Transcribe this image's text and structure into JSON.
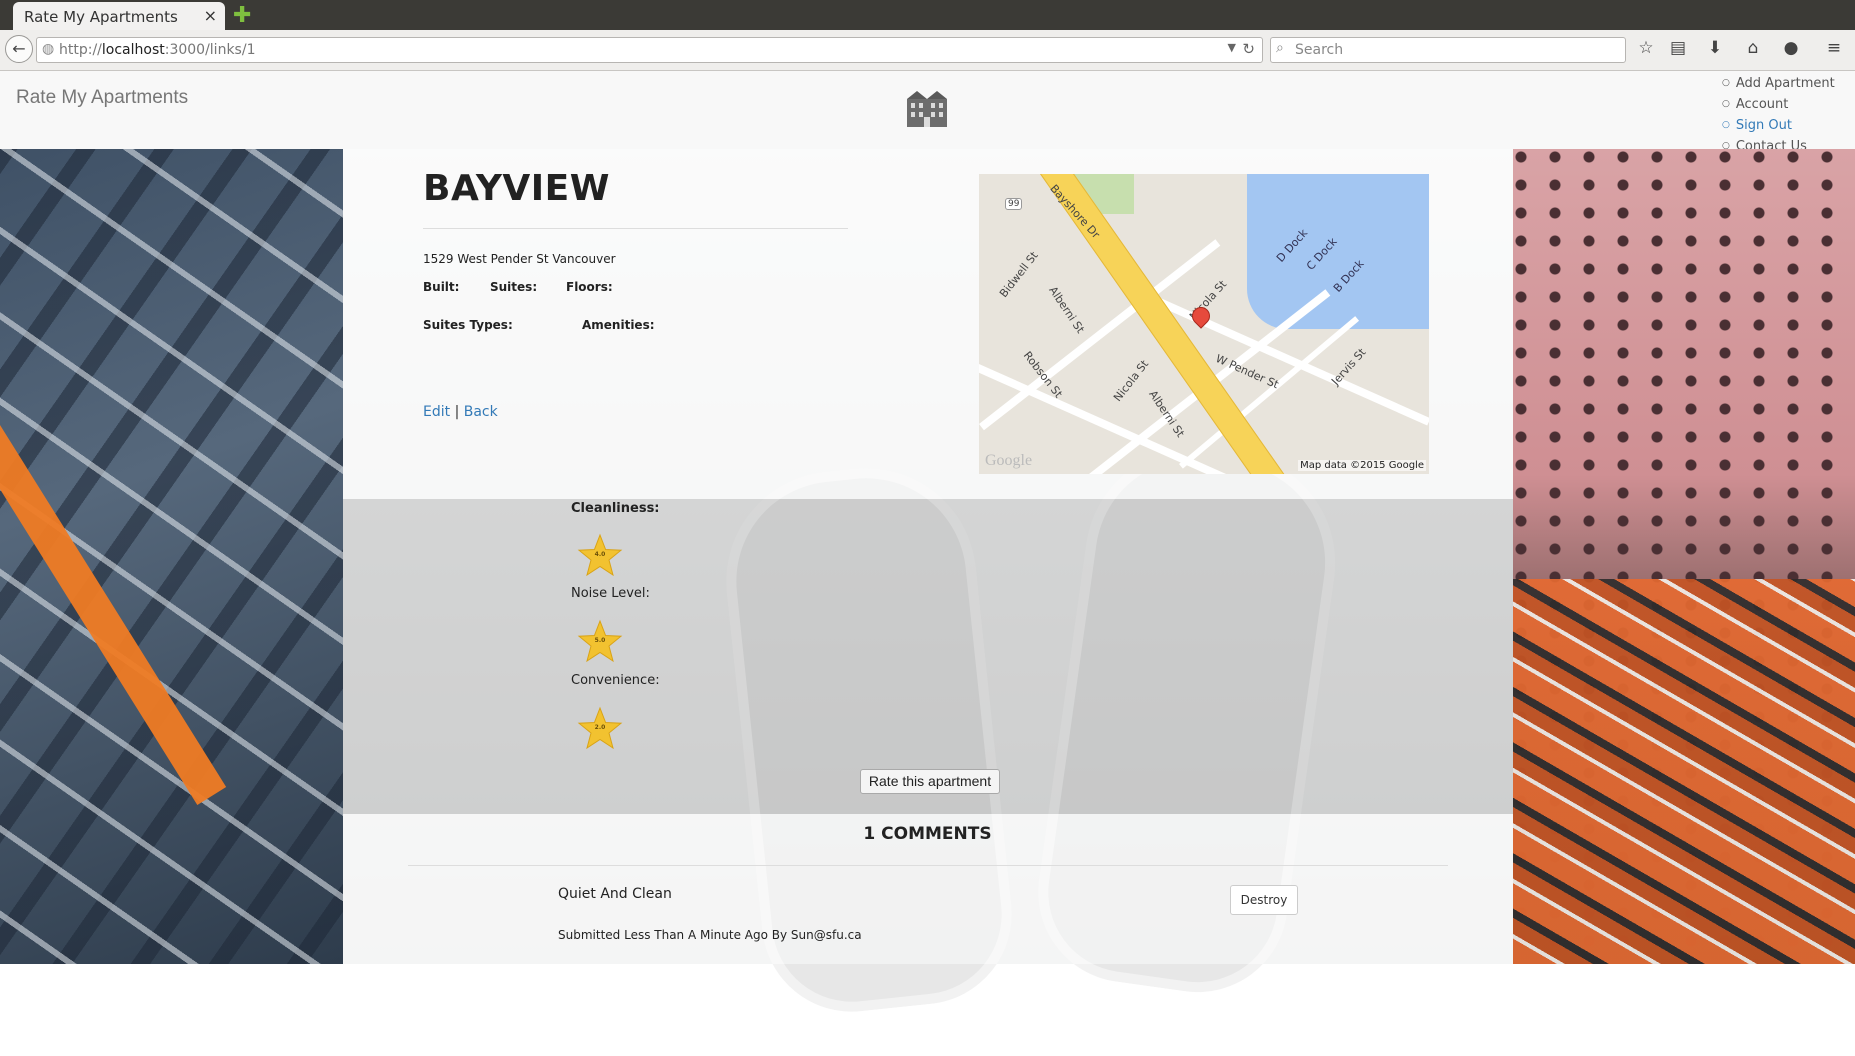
{
  "browser": {
    "tab_title": "Rate My Apartments",
    "tab_close": "×",
    "new_tab": "✚",
    "url_prefix": "http://",
    "url_host": "localhost",
    "url_rest": ":3000/links/1",
    "search_placeholder": "Search"
  },
  "header": {
    "brand": "Rate My Apartments",
    "nav": [
      {
        "label": "Add Apartment"
      },
      {
        "label": "Account"
      },
      {
        "label": "Sign Out"
      },
      {
        "label": "Contact Us"
      }
    ]
  },
  "apartment": {
    "name": "BAYVIEW",
    "address": "1529 West Pender St Vancouver",
    "built_label": "Built:",
    "suites_label": "Suites:",
    "floors_label": "Floors:",
    "suite_types_label": "Suites Types:",
    "amenities_label": "Amenities:",
    "edit_link": "Edit",
    "separator": "|",
    "back_link": "Back"
  },
  "map": {
    "streets": [
      "Bayshore Dr",
      "Bidwell St",
      "Alberni St",
      "Nicola St",
      "Robson St",
      "Nicola St",
      "Alberni St",
      "W Pender St",
      "Jervis St",
      "D Dock",
      "C Dock",
      "B Dock"
    ],
    "highway_shield": "99",
    "attribution": "Map data ©2015 Google",
    "logo": "Google"
  },
  "ratings": [
    {
      "label": "Cleanliness:",
      "value": "4.0"
    },
    {
      "label": "Noise Level:",
      "value": "5.0"
    },
    {
      "label": "Convenience:",
      "value": "2.0"
    }
  ],
  "rate_button": "Rate this apartment",
  "comments": {
    "heading": "1 COMMENTS",
    "items": [
      {
        "title": "Quiet And Clean",
        "meta": "Submitted Less Than A Minute Ago By Sun@sfu.ca",
        "destroy": "Destroy"
      }
    ]
  },
  "colors": {
    "link": "#337ab7",
    "star": "#f2c230",
    "accent_orange": "#ef7b24"
  }
}
